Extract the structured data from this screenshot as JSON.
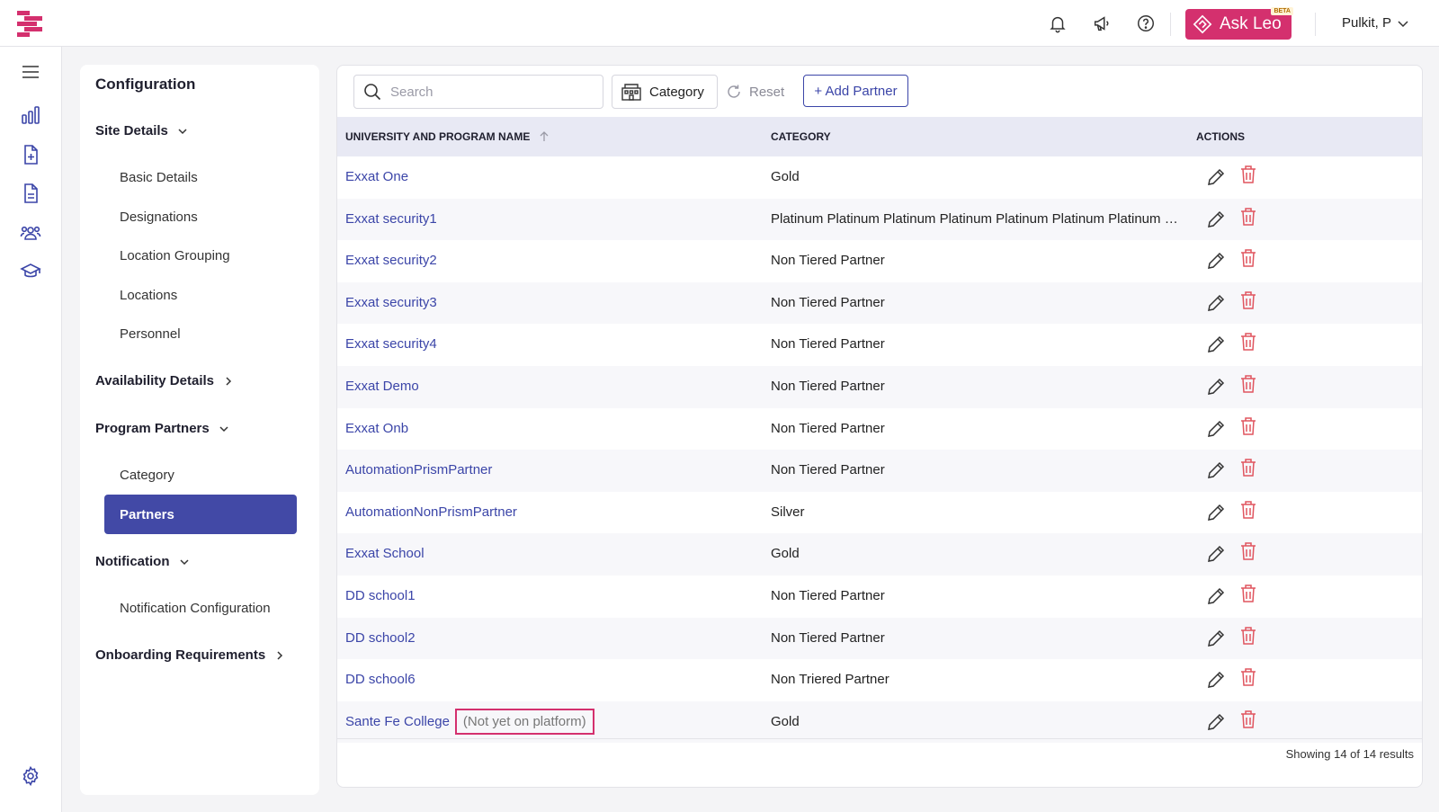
{
  "topbar": {
    "logo_icon": "exxat-logo-icon",
    "icons": [
      "bell-icon",
      "megaphone-icon",
      "help-icon"
    ],
    "ask_leo_label": "Ask Leo",
    "ask_leo_badge": "BETA",
    "user_name": "Pulkit, P",
    "accent_color": "#d4306e"
  },
  "rail": {
    "icons": [
      "hamburger-menu-icon",
      "bar-chart-icon",
      "file-add-icon",
      "document-icon",
      "people-icon",
      "graduation-cap-icon",
      "settings-gear-icon"
    ]
  },
  "config": {
    "title": "Configuration",
    "sections": [
      {
        "label": "Site Details",
        "expanded": true,
        "items": [
          "Basic Details",
          "Designations",
          "Location Grouping",
          "Locations",
          "Personnel"
        ]
      },
      {
        "label": "Availability Details",
        "expanded": false,
        "items": []
      },
      {
        "label": "Program Partners",
        "expanded": true,
        "items": [
          "Category",
          "Partners"
        ],
        "active": "Partners"
      },
      {
        "label": "Notification",
        "expanded": true,
        "items": [
          "Notification Configuration"
        ]
      },
      {
        "label": "Onboarding Requirements",
        "expanded": false,
        "items": []
      }
    ],
    "active_color": "#4249a6"
  },
  "toolbar": {
    "search_placeholder": "Search",
    "category_label": "Category",
    "reset_label": "Reset",
    "add_partner_label": "+ Add Partner"
  },
  "table": {
    "columns": [
      "UNIVERSITY AND PROGRAM NAME",
      "CATEGORY",
      "ACTIONS"
    ],
    "sort": "ascending",
    "rows": [
      {
        "name": "Exxat One",
        "category": "Gold"
      },
      {
        "name": "Exxat security1",
        "category": "Platinum Platinum Platinum Platinum Platinum Platinum Platinum Platinum Platinum"
      },
      {
        "name": "Exxat security2",
        "category": "Non Tiered Partner"
      },
      {
        "name": "Exxat security3",
        "category": "Non Tiered Partner"
      },
      {
        "name": "Exxat security4",
        "category": "Non Tiered Partner"
      },
      {
        "name": "Exxat Demo",
        "category": "Non Tiered Partner"
      },
      {
        "name": "Exxat Onb",
        "category": "Non Tiered Partner"
      },
      {
        "name": "AutomationPrismPartner",
        "category": "Non Tiered Partner"
      },
      {
        "name": "AutomationNonPrismPartner",
        "category": "Silver"
      },
      {
        "name": "Exxat School",
        "category": "Gold"
      },
      {
        "name": "DD school1",
        "category": "Non Tiered Partner"
      },
      {
        "name": "DD school2",
        "category": "Non Tiered Partner"
      },
      {
        "name": "DD school6",
        "category": "Non Triered Partner"
      },
      {
        "name": "Sante Fe College",
        "category": "Gold",
        "tag": "(Not yet on platform)"
      }
    ],
    "results_text": "Showing 14 of 14 results"
  }
}
